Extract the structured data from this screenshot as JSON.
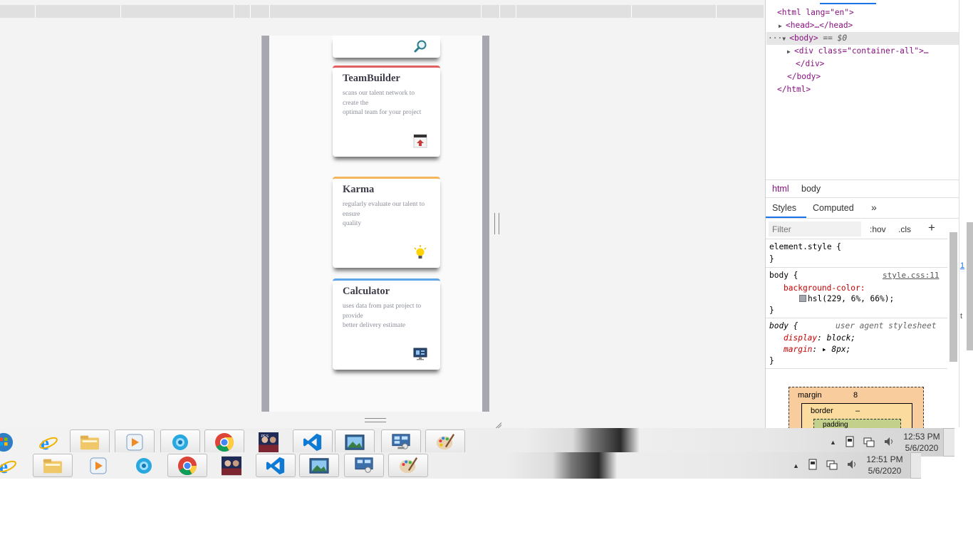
{
  "cards": [
    {
      "title": "TeamBuilder",
      "lines": [
        "scans our talent network to",
        "create the",
        "optimal team for your project"
      ],
      "accent": "#e15f5f",
      "icon": "calendar-icon"
    },
    {
      "title": "Karma",
      "lines": [
        "regularly evaluate our talent to",
        "ensure",
        "quality"
      ],
      "accent": "#f3b65b",
      "icon": "lightbulb-icon"
    },
    {
      "title": "Calculator",
      "lines": [
        "uses data from past project to",
        "provide",
        "better delivery estimate"
      ],
      "accent": "#5fa6e9",
      "icon": "monitor-icon"
    }
  ],
  "devtools": {
    "dom": {
      "html_open": "<html lang=\"en\">",
      "head": "<head>…</head>",
      "body_dots": "···",
      "body_open": "<body>",
      "body_eq": "== $0",
      "div": "<div class=\"container-all\">…",
      "div_close": "</div>",
      "body_close": "</body>",
      "html_close": "</html>"
    },
    "breadcrumbs": [
      "html",
      "body"
    ],
    "tabs": [
      "Styles",
      "Computed",
      "»"
    ],
    "filter_placeholder": "Filter",
    "hov": ":hov",
    "cls": ".cls",
    "plus": "+",
    "rules": {
      "element_style": "element.style {",
      "close": "}",
      "body_selector": "body {",
      "source": "style.css:11",
      "bg_prop": "background-color:",
      "bg_value": "hsl(229, 6%, 66%);",
      "swatch_color": "#a5a7b0",
      "ua_selector": "body {",
      "ua_label": "user agent stylesheet",
      "display_prop": "display",
      "display_value": ": block;",
      "margin_prop": "margin",
      "margin_value": ": ▸ 8px;"
    },
    "box_model": {
      "margin_label": "margin",
      "margin_value": "8",
      "border_label": "border",
      "border_value": "–",
      "padding_label": "padding"
    },
    "edge_text": [
      "1",
      "t"
    ]
  },
  "taskbar_top": {
    "time": "12:53 PM",
    "date": "5/6/2020"
  },
  "taskbar_bottom": {
    "time": "12:51 PM",
    "date": "5/6/2020"
  },
  "taskbar_apps": [
    "start-orb-icon",
    "internet-explorer-icon",
    "file-explorer-icon",
    "media-player-icon",
    "browser-swirl-icon",
    "chrome-icon",
    "football-game-icon",
    "vscode-icon",
    "photo-viewer-icon",
    "remote-desktop-icon",
    "paint-icon"
  ]
}
